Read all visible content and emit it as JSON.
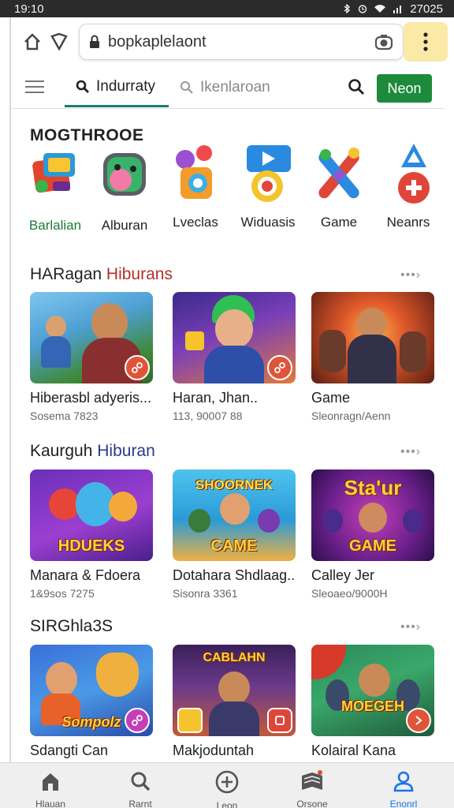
{
  "status_bar": {
    "time": "19:10",
    "right_text": "27025",
    "icons": [
      "bluetooth-icon",
      "alarm-icon",
      "wifi-icon",
      "signal-icon"
    ]
  },
  "browser": {
    "url": "bopkaplelaont",
    "icons": [
      "home-icon",
      "shield-icon",
      "lock-icon",
      "camera-icon",
      "more-vert-icon"
    ]
  },
  "tabs": {
    "active_label": "Indurraty",
    "search_placeholder": "Ikenlaroan",
    "cta_label": "Neon"
  },
  "categories": {
    "title": "MOGTHROOE",
    "items": [
      {
        "label": "Barlalian",
        "icon": "console-icon"
      },
      {
        "label": "Alburan",
        "icon": "gamepad-icon"
      },
      {
        "label": "Lveclas",
        "icon": "camera-app-icon"
      },
      {
        "label": "Widuasis",
        "icon": "video-icon"
      },
      {
        "label": "Game",
        "icon": "joystick-icon"
      },
      {
        "label": "Neanrs",
        "icon": "add-icon"
      }
    ]
  },
  "sections": [
    {
      "title_main": "HARagan",
      "title_accent": "Hiburans",
      "more": "•••›",
      "cards": [
        {
          "title": "Hiberasbl adyeris...",
          "subtitle": "Sosema 7823",
          "caption": ""
        },
        {
          "title": "Haran, Jhan..",
          "subtitle": "113, 90007 88",
          "caption": ""
        },
        {
          "title": "Game",
          "subtitle": "Sleonragn/Aenn",
          "caption": ""
        }
      ]
    },
    {
      "title_main": "Kaurguh",
      "title_accent": "Hiburan",
      "more": "•••›",
      "cards": [
        {
          "title": "Manara & Fdoera",
          "subtitle": "1&9sos 7275",
          "caption": "HDUEKS"
        },
        {
          "title": "Dotahara Shdlaag..",
          "subtitle": "Sisonra 3361",
          "caption": "CAME"
        },
        {
          "title": "Calley Jer",
          "subtitle": "Sleoaeo/9000H",
          "caption": "GAME"
        }
      ]
    },
    {
      "title_main": "SIRGhla3S",
      "title_accent": "",
      "more": "•••›",
      "cards": [
        {
          "title": "Sdangti Can",
          "subtitle": "",
          "caption": "Sompolz"
        },
        {
          "title": "Makjoduntah",
          "subtitle": "",
          "caption": "CABLAHN"
        },
        {
          "title": "Kolairal Kana",
          "subtitle": "",
          "caption": "MOEGEH"
        }
      ]
    }
  ],
  "bottom_nav": [
    {
      "label": "Hlauan",
      "icon": "home-icon"
    },
    {
      "label": "Rarnt",
      "icon": "search-icon"
    },
    {
      "label": "Leon",
      "icon": "add-circle-icon"
    },
    {
      "label": "Orsone",
      "icon": "library-icon"
    },
    {
      "label": "Enonrl",
      "icon": "person-icon"
    }
  ],
  "colors": {
    "accent_green": "#1e8a3c",
    "accent_red": "#b0302a",
    "menu_highlight": "#fbe9a6",
    "nav_active": "#1a73e8"
  }
}
